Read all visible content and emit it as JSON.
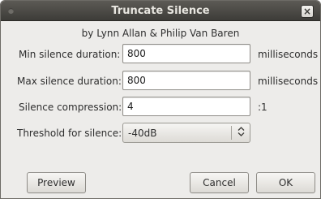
{
  "window": {
    "title": "Truncate Silence",
    "close_glyph": "×"
  },
  "byline": "by Lynn Allan & Philip Van Baren",
  "fields": {
    "min_silence": {
      "label": "Min silence duration:",
      "value": "800",
      "unit": "milliseconds"
    },
    "max_silence": {
      "label": "Max silence duration:",
      "value": "800",
      "unit": "milliseconds"
    },
    "compression": {
      "label": "Silence compression:",
      "value": "4",
      "unit": ":1"
    },
    "threshold": {
      "label": "Threshold for silence:",
      "value": "-40dB",
      "arrow_glyph": "⌃⌄"
    }
  },
  "buttons": {
    "preview": "Preview",
    "cancel": "Cancel",
    "ok": "OK"
  }
}
